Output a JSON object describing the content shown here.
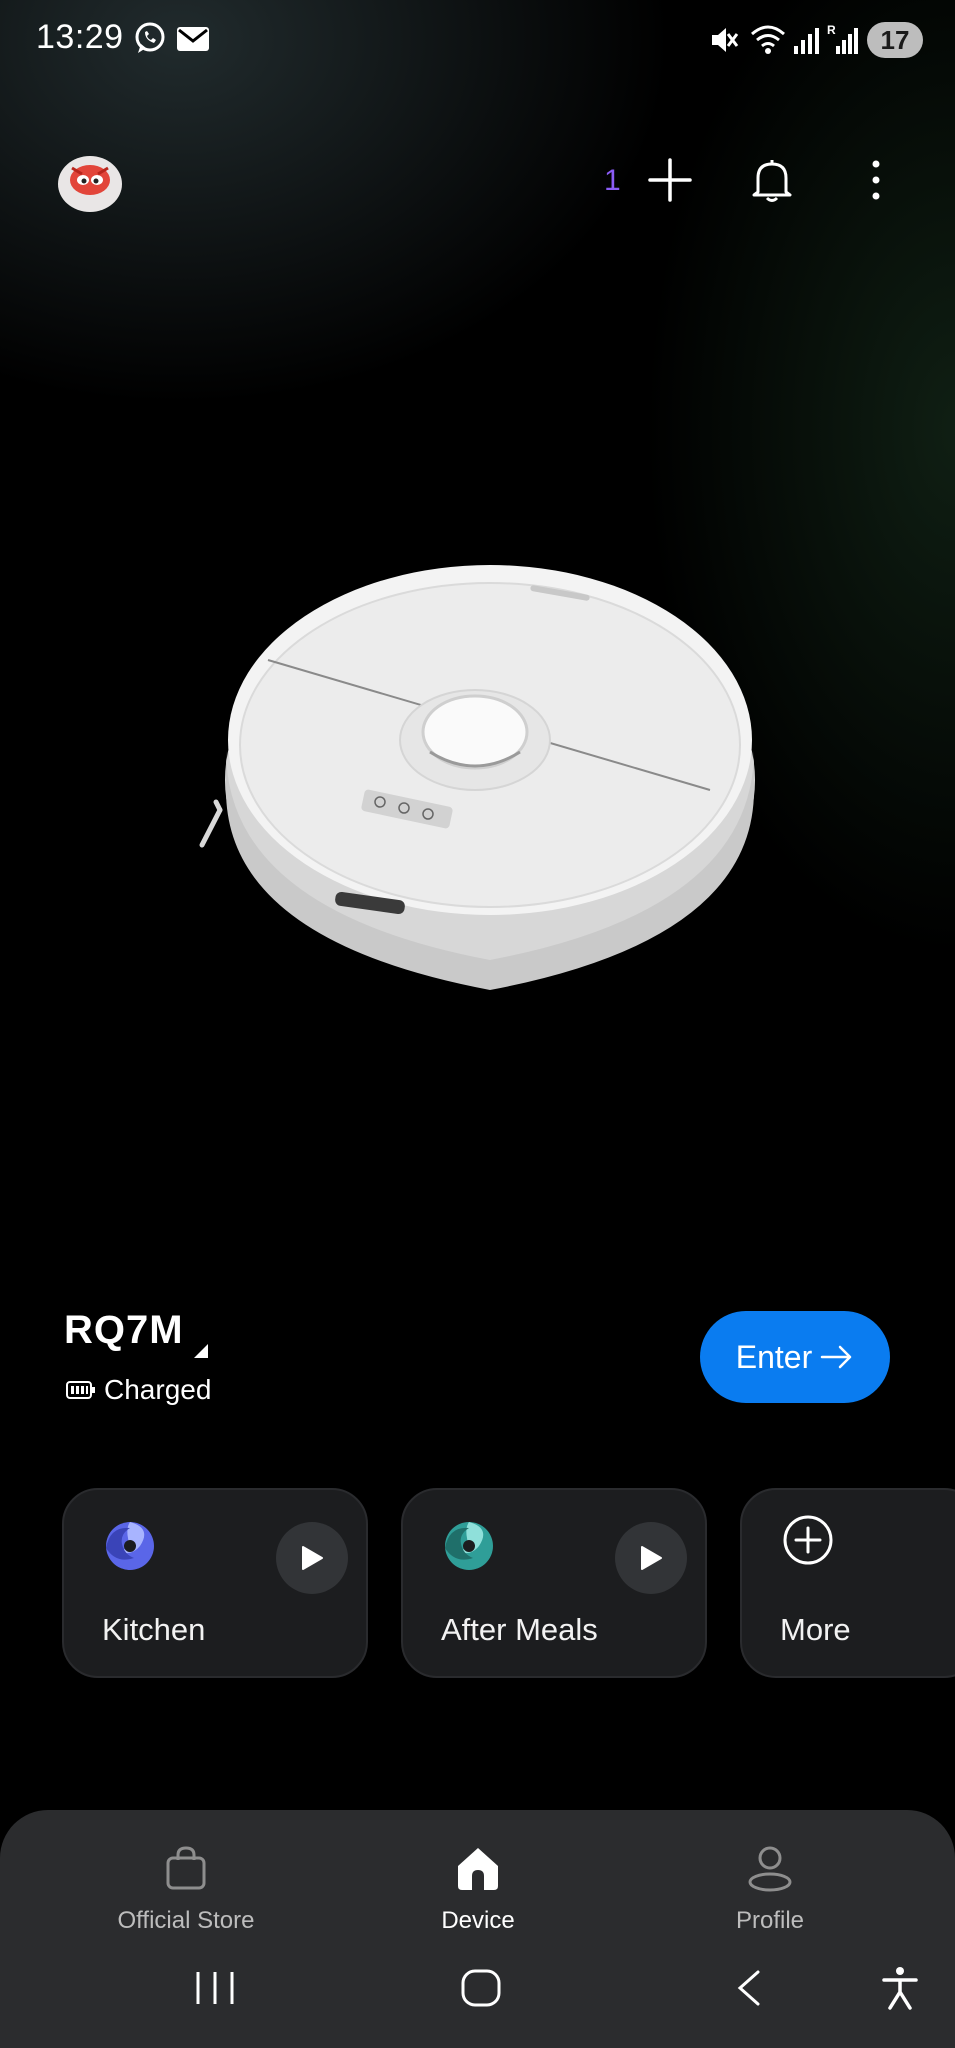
{
  "status_bar": {
    "time": "13:29",
    "icons": [
      "whatsapp-icon",
      "mail-icon",
      "mute-icon",
      "wifi-icon",
      "signal-icon",
      "roaming-signal-icon"
    ],
    "battery": "17"
  },
  "header": {
    "notification_count": "1",
    "icons": [
      "avatar",
      "add-icon",
      "bell-icon",
      "more-icon"
    ]
  },
  "device": {
    "name": "RQ7M",
    "status": "Charged",
    "enter_label": "Enter"
  },
  "scenes": [
    {
      "label": "Kitchen",
      "icon": "scene-swirl-icon",
      "color": "#6b7bff"
    },
    {
      "label": "After Meals",
      "icon": "scene-swirl-icon",
      "color": "#3fb8b0"
    },
    {
      "label": "More",
      "icon": "add-circle-icon"
    }
  ],
  "bottom_nav": {
    "items": [
      {
        "label": "Official Store",
        "icon": "shopping-bag-icon",
        "active": false
      },
      {
        "label": "Device",
        "icon": "home-icon",
        "active": true
      },
      {
        "label": "Profile",
        "icon": "person-icon",
        "active": false
      }
    ]
  },
  "colors": {
    "accent": "#0a7cf0",
    "notification": "#8b5cf6",
    "card_bg": "#1c1d1f",
    "nav_bg": "#2b2c2e"
  }
}
